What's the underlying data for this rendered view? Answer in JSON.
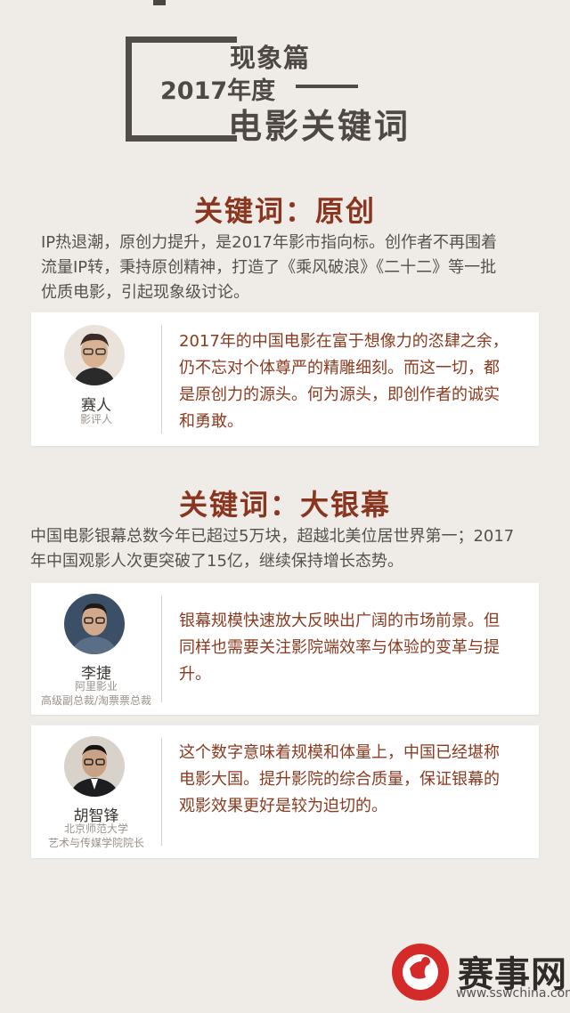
{
  "header": {
    "line1": "现象篇",
    "line2": "2017年度",
    "line3": "电影关键词"
  },
  "section1": {
    "title": "关键词：原创",
    "intro": [
      "IP热退潮，原创力提升，是2017年影市指向标。创作者不再围着",
      "流量IP转，秉持原创精神，打造了《乘风破浪》《二十二》等一批",
      "优质电影，引起现象级讨论。"
    ],
    "cards": [
      {
        "name": "赛人",
        "role": [
          "影评人"
        ],
        "quote": [
          "2017年的中国电影在富于想像力的恣肆之余，",
          "仍不忘对个体尊严的精雕细刻。而这一切，都",
          "是原创力的源头。何为源头，即创作者的诚实",
          "和勇敢。"
        ]
      }
    ]
  },
  "section2": {
    "title": "关键词：大银幕",
    "intro": [
      "中国电影银幕总数今年已超过5万块，超越北美位居世界第一；2017",
      "年中国观影人次更突破了15亿，继续保持增长态势。"
    ],
    "cards": [
      {
        "name": "李捷",
        "role": [
          "阿里影业",
          "高级副总裁/淘票票总裁"
        ],
        "quote": [
          "银幕规模快速放大反映出广阔的市场前景。但",
          "同样也需要关注影院端效率与体验的变革与提",
          "升。"
        ]
      },
      {
        "name": "胡智锋",
        "role": [
          "北京师范大学",
          "艺术与传媒学院院长"
        ],
        "quote": [
          "这个数字意味着规模和体量上，中国已经堪称",
          "电影大国。提升影院的综合质量，保证银幕的",
          "观影效果更好是较为迫切的。"
        ]
      }
    ]
  },
  "footer": {
    "brand": "赛事网",
    "url": "www.sswchina.com"
  },
  "colors": {
    "background": "#efece7",
    "keyword_title": "#8a3520",
    "quote_text": "#8a3a1f",
    "logo_red": "#d42a2a"
  }
}
